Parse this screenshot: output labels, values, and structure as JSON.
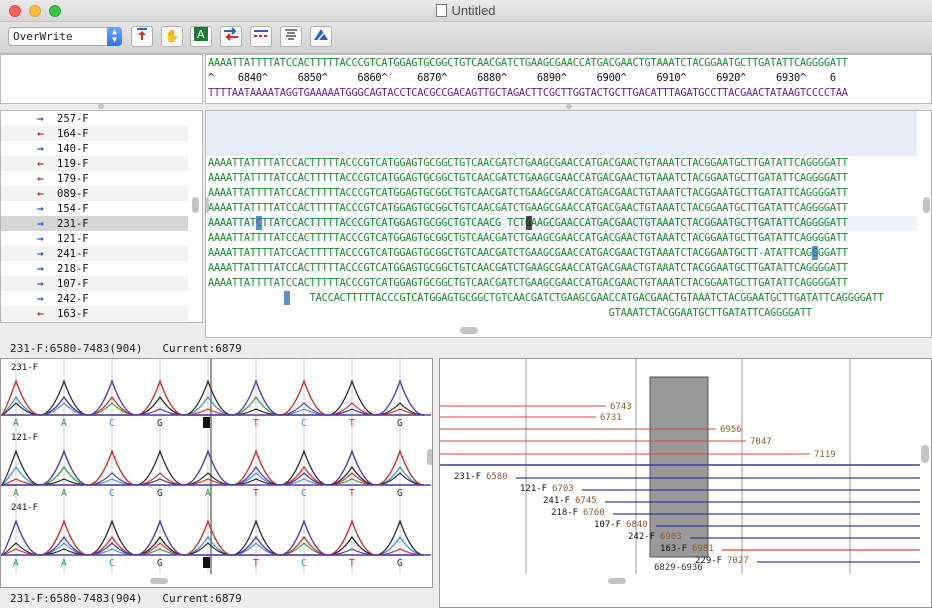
{
  "window": {
    "title": "Untitled"
  },
  "toolbar": {
    "mode": "OverWrite",
    "icons": [
      "align-top-icon",
      "hand-icon",
      "font-icon",
      "swap-icon",
      "gap-icon",
      "lines-icon",
      "tools-icon"
    ]
  },
  "consensus": {
    "top": "AAAATTATTTTATCCACTTTTTACCCGTCATGGAGTGCGGCTGTCAACGATCTGAAGCGAACCATGACGAACTGTAAATCTACGGAATGCTTGATATTCAGGGGATT",
    "ruler": "^    6840^     6850^     6860^     6870^     6880^     6890^     6900^     6910^     6920^     6930^    6",
    "bottom": "TTTTAATAAAATAGGTGAAAAATGGGCAGTACCTCACGCCGACAGTTGCTAGACTTCGCTTGGTACTGCTTGACATTTAGATGCCTTACGAACTATAAGTCCCCTAA"
  },
  "reads": [
    {
      "name": "257-F",
      "dir": "fwd",
      "seq": ""
    },
    {
      "name": "164-F",
      "dir": "rev",
      "seq": ""
    },
    {
      "name": "140-F",
      "dir": "fwd",
      "seq": ""
    },
    {
      "name": "119-F",
      "dir": "rev",
      "seq": "AAAATTATTTTATCCACTTTTTACCCGTCATGGAGTGCGGCTGTCAACGATCTGAAGCGAACCATGACGAACTGTAAATCTACGGAATGCTTGATATTCAGGGGATT"
    },
    {
      "name": "179-F",
      "dir": "rev",
      "seq": "AAAATTATTTTATCCACTTTTTACCCGTCATGGAGTGCGGCTGTCAACGATCTGAAGCGAACCATGACGAACTGTAAATCTACGGAATGCTTGATATTCAGGGGATT"
    },
    {
      "name": "089-F",
      "dir": "rev",
      "seq": "AAAATTATTTTATCCACTTTTTACCCGTCATGGAGTGCGGCTGTCAACGATCTGAAGCGAACCATGACGAACTGTAAATCTACGGAATGCTTGATATTCAGGGGATT"
    },
    {
      "name": "154-F",
      "dir": "fwd",
      "seq": "AAAATTATTTTATCCACTTTTTACCCGTCATGGAGTGCGGCTGTCAACGATCTGAAGCGAACCATGACGAACTGTAAATCTACGGAATGCTTGATATTCAGGGGATT"
    },
    {
      "name": "231-F",
      "dir": "fwd",
      "seq": "AAAATTATCTTATCCACTTTTTACCCGTCATGGAGTGCGGCTGTCAACG TCTGAAGCGAACCATGACGAACTGTAAATCTACGGAATGCTTGATATTCAGGGGATT"
    },
    {
      "name": "121-F",
      "dir": "fwd",
      "seq": "AAAATTATTTTATCCACTTTTTACCCGTCATGGAGTGCGGCTGTCAACGATCTGAAGCGAACCATGACGAACTGTAAATCTACGGAATGCTTGATATTCAGGGGATT"
    },
    {
      "name": "241-F",
      "dir": "fwd",
      "seq": "AAAATTATTTTATCCACTTTTTACCCGTCATGGAGTGCGGCTGTCAACGATCTGAAGCGAACCATGACGAACTGTAAATCTACGGAATGCTT-ATATTCAGGGGATT"
    },
    {
      "name": "218-F",
      "dir": "fwd",
      "seq": "AAAATTATTTTATCCACTTTTTACCCGTCATGGAGTGCGGCTGTCAACGATCTGAAGCGAACCATGACGAACTGTAAATCTACGGAATGCTTGATATTCAGGGGATT"
    },
    {
      "name": "107-F",
      "dir": "fwd",
      "seq": "AAAATTATTTTATCCACTTTTTACCCGTCATGGAGTGCGGCTGTCAACGATCTGAAGCGAACCATGACGAACTGTAAATCTACGGAATGCTTGATATTCAGGGGATT"
    },
    {
      "name": "242-F",
      "dir": "fwd",
      "seq": "                 TACCACTTTTTACCCGTCATGGAGTGCGGCTGTCAACGATCTGAAGCGAACCATGACGAACTGTAAATCTACGGAATGCTTGATATTCAGGGGATT"
    },
    {
      "name": "163-F",
      "dir": "rev",
      "seq": "                                                                   GTAAATCTACGGAATGCTTGATATTCAGGGGATT"
    }
  ],
  "status_top": {
    "read_info": "231-F:6580-7483(904)",
    "current": "Current:6879"
  },
  "status_bottom": {
    "read_info": "231-F:6580-7483(904)",
    "current": "Current:6879"
  },
  "traces": [
    {
      "name": "231-F",
      "bases": [
        "A",
        "A",
        "C",
        "G",
        "",
        "T",
        "C",
        "T",
        "G"
      ]
    },
    {
      "name": "121-F",
      "bases": [
        "A",
        "A",
        "C",
        "G",
        "A",
        "T",
        "C",
        "T",
        "G"
      ]
    },
    {
      "name": "241-F",
      "bases": [
        "A",
        "A",
        "C",
        "G",
        "",
        "T",
        "C",
        "T",
        "G"
      ]
    }
  ],
  "assembly": {
    "ticks": [
      "6743",
      "6731",
      "6956",
      "7047",
      "7119"
    ],
    "reads": [
      {
        "name": "231-F",
        "pos": "6580"
      },
      {
        "name": "121-F",
        "pos": "6703"
      },
      {
        "name": "241-F",
        "pos": "6745"
      },
      {
        "name": "218-F",
        "pos": "6760"
      },
      {
        "name": "107-F",
        "pos": "6840"
      },
      {
        "name": "242-F",
        "pos": "6903"
      },
      {
        "name": "163-F",
        "pos": "6981"
      },
      {
        "name": "229-F",
        "pos": "7027"
      }
    ],
    "region": "6829-6936",
    "cut": "201 F 7080"
  }
}
